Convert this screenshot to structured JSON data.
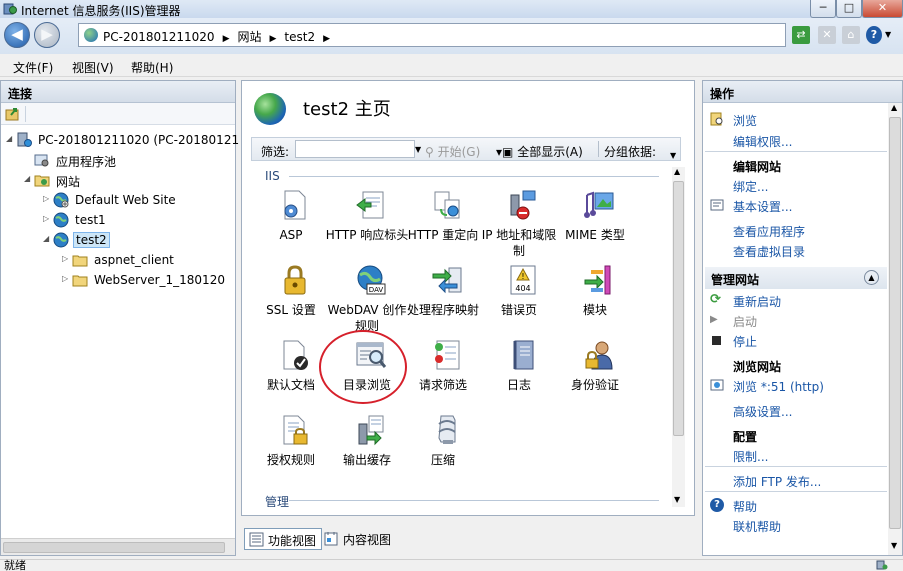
{
  "window": {
    "title": "Internet 信息服务(IIS)管理器",
    "min": "─",
    "max": "□",
    "close": "✕"
  },
  "nav": {
    "breadcrumbs": [
      "PC-201801211020",
      "网站",
      "test2"
    ],
    "separator": "▶",
    "help": "?"
  },
  "menu": [
    "文件(F)",
    "视图(V)",
    "帮助(H)"
  ],
  "connections": {
    "title": "连接",
    "tree": [
      {
        "label": "PC-201801211020 (PC-20180121",
        "icon": "server-icon",
        "expander": "◢"
      },
      {
        "label": "应用程序池",
        "icon": "app-pool-icon",
        "expander": ""
      },
      {
        "label": "网站",
        "icon": "sites-folder-icon",
        "expander": "◢"
      },
      {
        "label": "Default Web Site",
        "icon": "globe-icon",
        "expander": "▷"
      },
      {
        "label": "test1",
        "icon": "globe-icon",
        "expander": "▷"
      },
      {
        "label": "test2",
        "icon": "globe-icon",
        "expander": "◢"
      },
      {
        "label": "aspnet_client",
        "icon": "folder-icon",
        "expander": "▷"
      },
      {
        "label": "WebServer_1_180120",
        "icon": "folder-icon",
        "expander": "▷"
      }
    ]
  },
  "center": {
    "title": "test2 主页",
    "filter": {
      "label": "筛选:",
      "value": "",
      "start": "开始(G)",
      "show_all": "全部显示(A)",
      "group_by": "分组依据:"
    },
    "groups": [
      {
        "name": "IIS"
      },
      {
        "name": "管理"
      }
    ],
    "features": [
      {
        "label": "ASP",
        "icon": "asp-icon"
      },
      {
        "label": "HTTP 响应标头",
        "icon": "http-response-headers-icon"
      },
      {
        "label": "HTTP 重定向",
        "icon": "http-redirect-icon"
      },
      {
        "label": "IP 地址和域限制",
        "icon": "ip-restrictions-icon"
      },
      {
        "label": "MIME 类型",
        "icon": "mime-types-icon"
      },
      {
        "label": "SSL 设置",
        "icon": "ssl-lock-icon"
      },
      {
        "label": "WebDAV 创作规则",
        "icon": "webdav-icon"
      },
      {
        "label": "处理程序映射",
        "icon": "handler-mappings-icon"
      },
      {
        "label": "错误页",
        "icon": "error-pages-icon"
      },
      {
        "label": "模块",
        "icon": "modules-icon"
      },
      {
        "label": "默认文档",
        "icon": "default-document-icon"
      },
      {
        "label": "目录浏览",
        "icon": "directory-browsing-icon"
      },
      {
        "label": "请求筛选",
        "icon": "request-filtering-icon"
      },
      {
        "label": "日志",
        "icon": "logging-icon"
      },
      {
        "label": "身份验证",
        "icon": "authentication-icon"
      },
      {
        "label": "授权规则",
        "icon": "authorization-rules-icon"
      },
      {
        "label": "输出缓存",
        "icon": "output-caching-icon"
      },
      {
        "label": "压缩",
        "icon": "compression-icon"
      }
    ],
    "view_tabs": [
      "功能视图",
      "内容视图"
    ]
  },
  "actions": {
    "title": "操作",
    "browse": "浏览",
    "edit_permissions": "编辑权限...",
    "edit_site_head": "编辑网站",
    "bindings": "绑定...",
    "basic_settings": "基本设置...",
    "view_applications": "查看应用程序",
    "view_virtual_dirs": "查看虚拟目录",
    "manage_site": "管理网站",
    "restart": "重新启动",
    "start": "启动",
    "stop": "停止",
    "browse_site_head": "浏览网站",
    "browse_port": "浏览 *:51 (http)",
    "advanced_settings": "高级设置...",
    "config_head": "配置",
    "limits": "限制...",
    "add_ftp": "添加 FTP 发布...",
    "help": "帮助",
    "online_help": "联机帮助"
  },
  "status": {
    "text": "就绪"
  }
}
